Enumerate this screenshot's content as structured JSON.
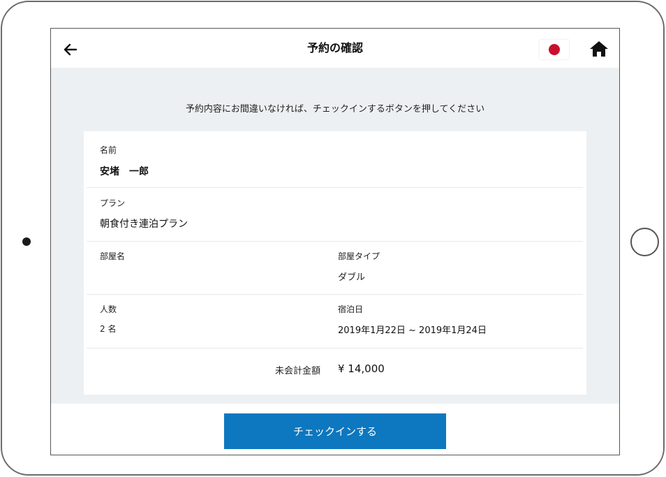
{
  "header": {
    "title": "予約の確認"
  },
  "instruction": "予約内容にお間違いなければ、チェックインするボタンを押してください",
  "reservation": {
    "name_label": "名前",
    "name_value": "安堵　一郎",
    "plan_label": "プラン",
    "plan_value": "朝食付き連泊プラン",
    "room_name_label": "部屋名",
    "room_name_value": "",
    "room_type_label": "部屋タイプ",
    "room_type_value": "ダブル",
    "guests_label": "人数",
    "guests_value": "2 名",
    "stay_dates_label": "宿泊日",
    "stay_dates_value": "2019年1月22日 ~ 2019年1月24日",
    "unpaid_total_label": "未会計金額",
    "unpaid_total_value": "¥ 14,000"
  },
  "footer": {
    "checkin_label": "チェックインする"
  },
  "icons": {
    "back": "arrow-left-icon",
    "language": "japan-flag-icon",
    "home": "home-icon"
  },
  "colors": {
    "primary_button": "#0d77bf",
    "flag_red": "#c8102e",
    "content_bg": "#edf0f2"
  }
}
